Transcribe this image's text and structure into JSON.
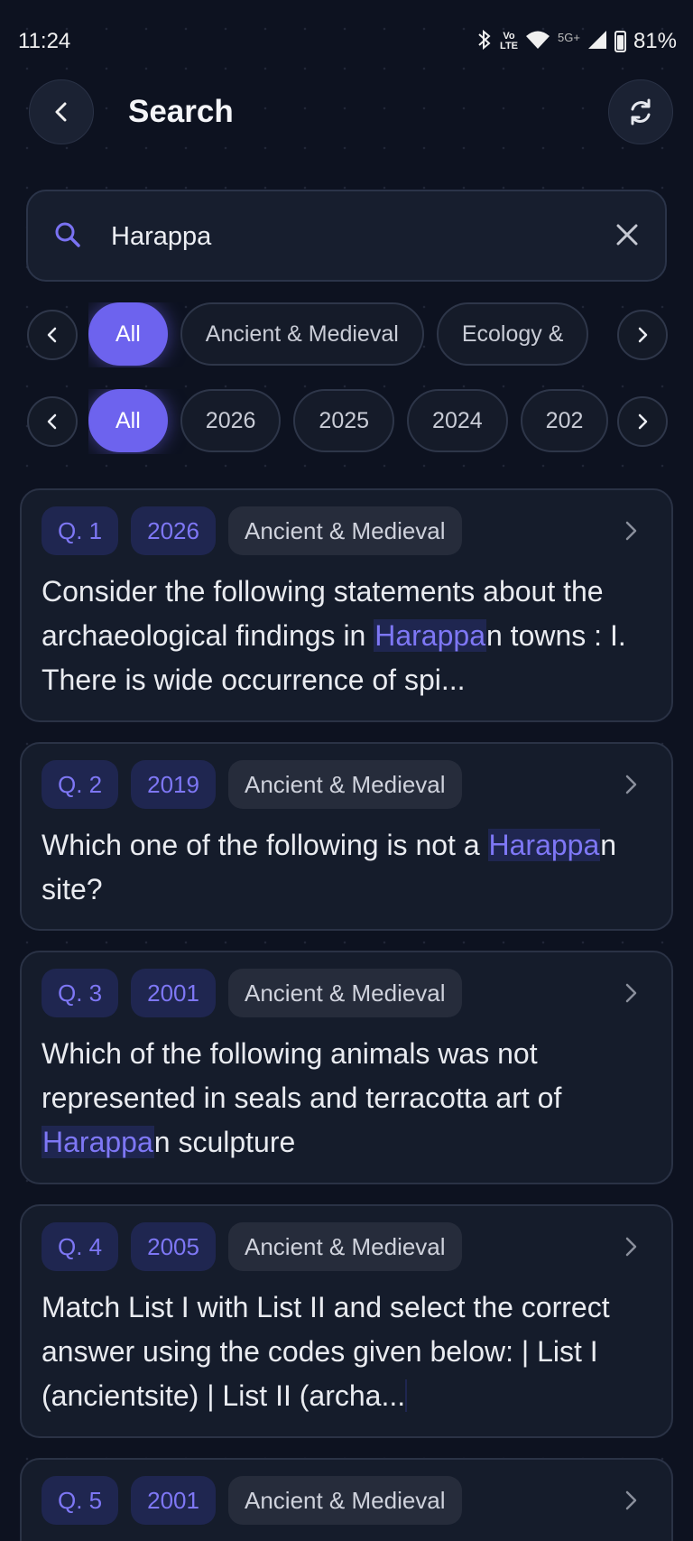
{
  "status_bar": {
    "time": "11:24",
    "bt_glyph": "✱",
    "volte": "Vo\nLTE",
    "network": "5G+",
    "battery": "81%"
  },
  "header": {
    "title": "Search"
  },
  "search": {
    "value": "Harappa",
    "placeholder": ""
  },
  "subject_filter": {
    "chips": [
      "All",
      "Ancient & Medieval",
      "Ecology &"
    ],
    "selected": "All"
  },
  "year_filter": {
    "chips": [
      "All",
      "2026",
      "2025",
      "2024",
      "202"
    ],
    "selected": "All"
  },
  "results": [
    {
      "q": "Q. 1",
      "year": "2026",
      "subject": "Ancient & Medieval",
      "pre": "Consider the following statements about the archaeological findings in ",
      "hl": "Harappa",
      "post": "n towns : I. There is wide occurrence of spi..."
    },
    {
      "q": "Q. 2",
      "year": "2019",
      "subject": "Ancient & Medieval",
      "pre": "Which one of the following is not a ",
      "hl": "Harappa",
      "post": "n site?"
    },
    {
      "q": "Q. 3",
      "year": "2001",
      "subject": "Ancient & Medieval",
      "pre": "Which of the following animals was not represented in seals and terracotta art of ",
      "hl": "Harappa",
      "post": "n sculpture"
    },
    {
      "q": "Q. 4",
      "year": "2005",
      "subject": "Ancient & Medieval",
      "pre": "Match List I with List II and select the correct answer using the codes given below: | List I (ancientsite) | List II (archa...",
      "hl": "",
      "post": ""
    },
    {
      "q": "Q. 5",
      "year": "2001",
      "subject": "Ancient & Medieval",
      "pre": "",
      "hl": "",
      "post": ""
    }
  ]
}
